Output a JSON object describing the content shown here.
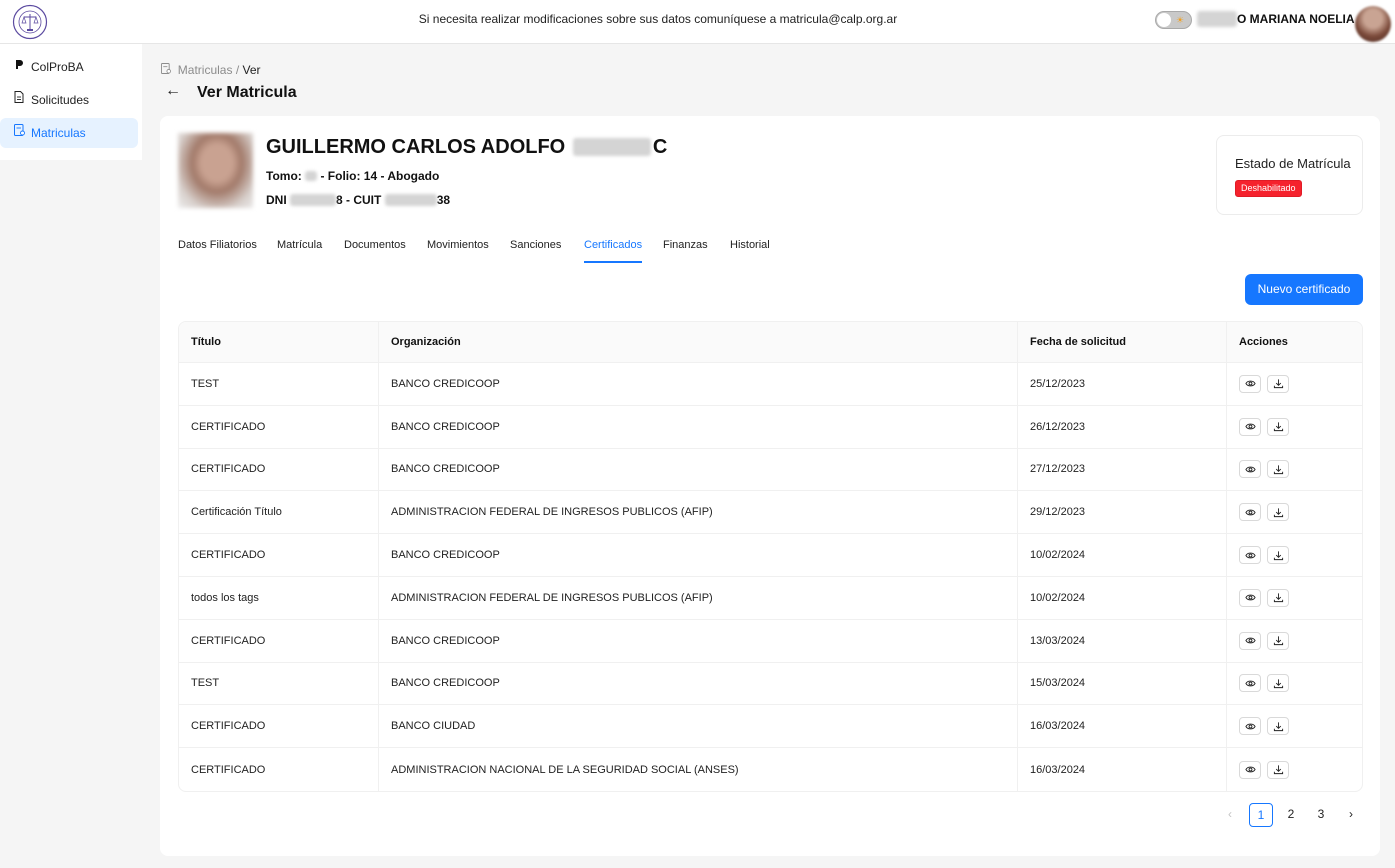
{
  "header": {
    "notice": "Si necesita realizar modificaciones sobre sus datos comuníquese a matricula@calp.org.ar",
    "username": "O MARIANA NOELIA",
    "theme_toggle_icon": "sun-icon"
  },
  "sidebar": {
    "items": [
      {
        "label": "ColProBA",
        "icon": "colproba-icon"
      },
      {
        "label": "Solicitudes",
        "icon": "document-icon"
      },
      {
        "label": "Matriculas",
        "icon": "matricula-icon"
      }
    ],
    "active_index": 2
  },
  "breadcrumb": {
    "items": [
      "Matriculas",
      "Ver"
    ]
  },
  "page": {
    "title": "Ver Matricula"
  },
  "profile": {
    "name_part1": "GUILLERMO CARLOS ADOLFO",
    "name_part2": "C",
    "tomo_label": "Tomo:",
    "tomo_rest": "- Folio: 14 - Abogado",
    "dni_label": "DNI",
    "dni_rest": "8 - CUIT",
    "cuit_suffix": "38"
  },
  "status": {
    "title": "Estado de Matrícula",
    "badge": "Deshabilitado",
    "badge_color": "#f5222d"
  },
  "tabs": [
    "Datos Filiatorios",
    "Matrícula",
    "Documentos",
    "Movimientos",
    "Sanciones",
    "Certificados",
    "Finanzas",
    "Historial"
  ],
  "active_tab": "Certificados",
  "actions": {
    "new_certificate": "Nuevo certificado"
  },
  "table": {
    "columns": [
      "Título",
      "Organización",
      "Fecha de solicitud",
      "Acciones"
    ],
    "rows": [
      {
        "titulo": "TEST",
        "organizacion": "BANCO CREDICOOP",
        "fecha": "25/12/2023"
      },
      {
        "titulo": "CERTIFICADO",
        "organizacion": "BANCO CREDICOOP",
        "fecha": "26/12/2023"
      },
      {
        "titulo": "CERTIFICADO",
        "organizacion": "BANCO CREDICOOP",
        "fecha": "27/12/2023"
      },
      {
        "titulo": "Certificación Título",
        "organizacion": "ADMINISTRACION FEDERAL DE INGRESOS PUBLICOS (AFIP)",
        "fecha": "29/12/2023"
      },
      {
        "titulo": "CERTIFICADO",
        "organizacion": "BANCO CREDICOOP",
        "fecha": "10/02/2024"
      },
      {
        "titulo": "todos los tags",
        "organizacion": "ADMINISTRACION FEDERAL DE INGRESOS PUBLICOS (AFIP)",
        "fecha": "10/02/2024"
      },
      {
        "titulo": "CERTIFICADO",
        "organizacion": "BANCO CREDICOOP",
        "fecha": "13/03/2024"
      },
      {
        "titulo": "TEST",
        "organizacion": "BANCO CREDICOOP",
        "fecha": "15/03/2024"
      },
      {
        "titulo": "CERTIFICADO",
        "organizacion": "BANCO CIUDAD",
        "fecha": "16/03/2024"
      },
      {
        "titulo": "CERTIFICADO",
        "organizacion": "ADMINISTRACION NACIONAL DE LA SEGURIDAD SOCIAL (ANSES)",
        "fecha": "16/03/2024"
      }
    ],
    "row_actions": [
      "eye-icon",
      "download-icon"
    ]
  },
  "pagination": {
    "pages": [
      "1",
      "2",
      "3"
    ],
    "current": "1",
    "prev_icon": "chevron-left-icon",
    "next_icon": "chevron-right-icon"
  },
  "colors": {
    "accent": "#1677ff",
    "active_sidebar_bg": "#e6f2ff"
  }
}
